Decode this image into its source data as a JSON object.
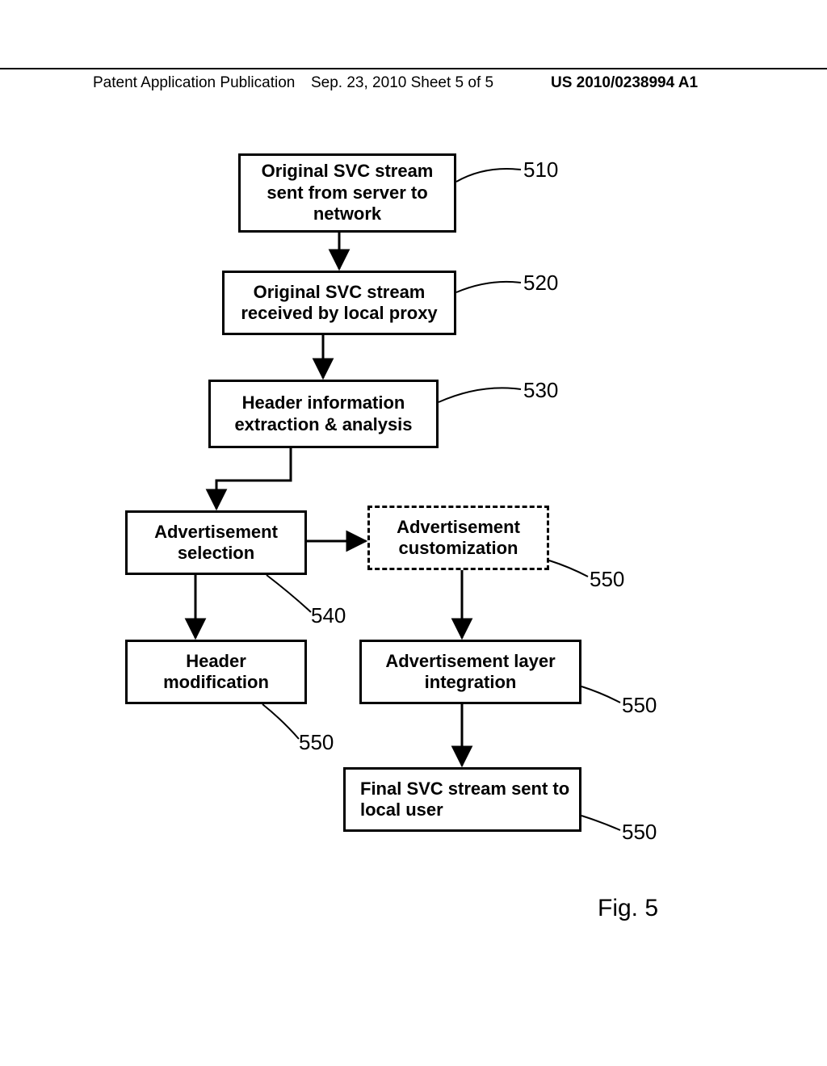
{
  "header": {
    "left": "Patent Application Publication",
    "mid": "Sep. 23, 2010  Sheet 5 of 5",
    "right": "US 2010/0238994 A1"
  },
  "nodes": {
    "n510": "Original SVC stream sent from server to network",
    "n520": "Original SVC stream received by local proxy",
    "n530": "Header information extraction & analysis",
    "n540a": "Advertisement selection",
    "n540b": "Advertisement customization",
    "n550a": "Header modification",
    "n550b": "Advertisement layer integration",
    "n550c": "Final SVC stream sent to local user"
  },
  "labels": {
    "l510": "510",
    "l520": "520",
    "l530": "530",
    "l540": "540",
    "l550_cust": "550",
    "l550_hdr": "550",
    "l550_int": "550",
    "l550_final": "550"
  },
  "figure_caption": "Fig. 5"
}
